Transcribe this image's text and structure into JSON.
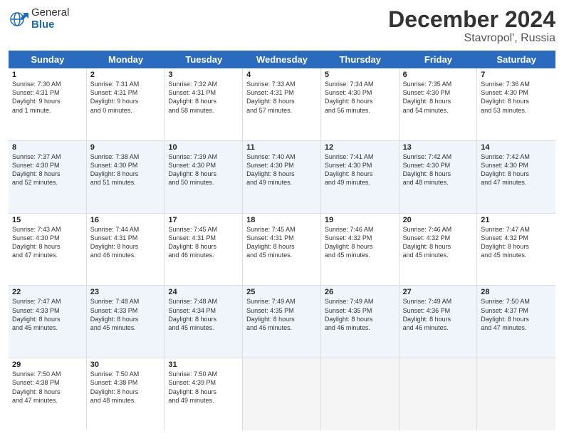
{
  "logo": {
    "general": "General",
    "blue": "Blue"
  },
  "title": "December 2024",
  "location": "Stavropol', Russia",
  "weekdays": [
    "Sunday",
    "Monday",
    "Tuesday",
    "Wednesday",
    "Thursday",
    "Friday",
    "Saturday"
  ],
  "weeks": [
    [
      {
        "day": "1",
        "info": "Sunrise: 7:30 AM\nSunset: 4:31 PM\nDaylight: 9 hours\nand 1 minute."
      },
      {
        "day": "2",
        "info": "Sunrise: 7:31 AM\nSunset: 4:31 PM\nDaylight: 9 hours\nand 0 minutes."
      },
      {
        "day": "3",
        "info": "Sunrise: 7:32 AM\nSunset: 4:31 PM\nDaylight: 8 hours\nand 58 minutes."
      },
      {
        "day": "4",
        "info": "Sunrise: 7:33 AM\nSunset: 4:31 PM\nDaylight: 8 hours\nand 57 minutes."
      },
      {
        "day": "5",
        "info": "Sunrise: 7:34 AM\nSunset: 4:30 PM\nDaylight: 8 hours\nand 56 minutes."
      },
      {
        "day": "6",
        "info": "Sunrise: 7:35 AM\nSunset: 4:30 PM\nDaylight: 8 hours\nand 54 minutes."
      },
      {
        "day": "7",
        "info": "Sunrise: 7:36 AM\nSunset: 4:30 PM\nDaylight: 8 hours\nand 53 minutes."
      }
    ],
    [
      {
        "day": "8",
        "info": "Sunrise: 7:37 AM\nSunset: 4:30 PM\nDaylight: 8 hours\nand 52 minutes."
      },
      {
        "day": "9",
        "info": "Sunrise: 7:38 AM\nSunset: 4:30 PM\nDaylight: 8 hours\nand 51 minutes."
      },
      {
        "day": "10",
        "info": "Sunrise: 7:39 AM\nSunset: 4:30 PM\nDaylight: 8 hours\nand 50 minutes."
      },
      {
        "day": "11",
        "info": "Sunrise: 7:40 AM\nSunset: 4:30 PM\nDaylight: 8 hours\nand 49 minutes."
      },
      {
        "day": "12",
        "info": "Sunrise: 7:41 AM\nSunset: 4:30 PM\nDaylight: 8 hours\nand 49 minutes."
      },
      {
        "day": "13",
        "info": "Sunrise: 7:42 AM\nSunset: 4:30 PM\nDaylight: 8 hours\nand 48 minutes."
      },
      {
        "day": "14",
        "info": "Sunrise: 7:42 AM\nSunset: 4:30 PM\nDaylight: 8 hours\nand 47 minutes."
      }
    ],
    [
      {
        "day": "15",
        "info": "Sunrise: 7:43 AM\nSunset: 4:30 PM\nDaylight: 8 hours\nand 47 minutes."
      },
      {
        "day": "16",
        "info": "Sunrise: 7:44 AM\nSunset: 4:31 PM\nDaylight: 8 hours\nand 46 minutes."
      },
      {
        "day": "17",
        "info": "Sunrise: 7:45 AM\nSunset: 4:31 PM\nDaylight: 8 hours\nand 46 minutes."
      },
      {
        "day": "18",
        "info": "Sunrise: 7:45 AM\nSunset: 4:31 PM\nDaylight: 8 hours\nand 45 minutes."
      },
      {
        "day": "19",
        "info": "Sunrise: 7:46 AM\nSunset: 4:32 PM\nDaylight: 8 hours\nand 45 minutes."
      },
      {
        "day": "20",
        "info": "Sunrise: 7:46 AM\nSunset: 4:32 PM\nDaylight: 8 hours\nand 45 minutes."
      },
      {
        "day": "21",
        "info": "Sunrise: 7:47 AM\nSunset: 4:32 PM\nDaylight: 8 hours\nand 45 minutes."
      }
    ],
    [
      {
        "day": "22",
        "info": "Sunrise: 7:47 AM\nSunset: 4:33 PM\nDaylight: 8 hours\nand 45 minutes."
      },
      {
        "day": "23",
        "info": "Sunrise: 7:48 AM\nSunset: 4:33 PM\nDaylight: 8 hours\nand 45 minutes."
      },
      {
        "day": "24",
        "info": "Sunrise: 7:48 AM\nSunset: 4:34 PM\nDaylight: 8 hours\nand 45 minutes."
      },
      {
        "day": "25",
        "info": "Sunrise: 7:49 AM\nSunset: 4:35 PM\nDaylight: 8 hours\nand 46 minutes."
      },
      {
        "day": "26",
        "info": "Sunrise: 7:49 AM\nSunset: 4:35 PM\nDaylight: 8 hours\nand 46 minutes."
      },
      {
        "day": "27",
        "info": "Sunrise: 7:49 AM\nSunset: 4:36 PM\nDaylight: 8 hours\nand 46 minutes."
      },
      {
        "day": "28",
        "info": "Sunrise: 7:50 AM\nSunset: 4:37 PM\nDaylight: 8 hours\nand 47 minutes."
      }
    ],
    [
      {
        "day": "29",
        "info": "Sunrise: 7:50 AM\nSunset: 4:38 PM\nDaylight: 8 hours\nand 47 minutes."
      },
      {
        "day": "30",
        "info": "Sunrise: 7:50 AM\nSunset: 4:38 PM\nDaylight: 8 hours\nand 48 minutes."
      },
      {
        "day": "31",
        "info": "Sunrise: 7:50 AM\nSunset: 4:39 PM\nDaylight: 8 hours\nand 49 minutes."
      },
      {
        "day": "",
        "info": ""
      },
      {
        "day": "",
        "info": ""
      },
      {
        "day": "",
        "info": ""
      },
      {
        "day": "",
        "info": ""
      }
    ]
  ]
}
